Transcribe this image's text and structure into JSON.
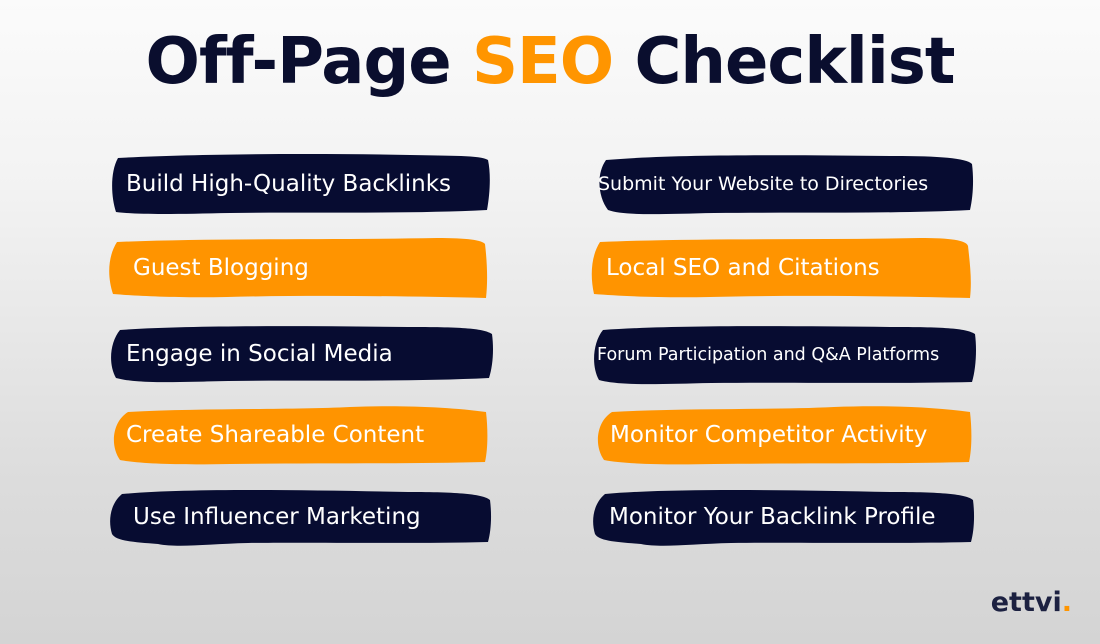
{
  "title": {
    "part1": "Off-Page ",
    "accent": "SEO",
    "part2": " Checklist"
  },
  "colors": {
    "navy": "#070c31",
    "orange": "#ff9400",
    "title_text": "#0a0e2e",
    "accent": "#ff9500"
  },
  "left_column": [
    {
      "label": "Build High-Quality Backlinks",
      "style": "navy"
    },
    {
      "label": "Guest Blogging",
      "style": "orange"
    },
    {
      "label": "Engage in Social Media",
      "style": "navy"
    },
    {
      "label": "Create Shareable Content",
      "style": "orange"
    },
    {
      "label": "Use Influencer Marketing",
      "style": "navy"
    }
  ],
  "right_column": [
    {
      "label": "Submit Your Website to Directories",
      "style": "navy"
    },
    {
      "label": "Local SEO and Citations",
      "style": "orange"
    },
    {
      "label": "Forum Participation and Q&A Platforms",
      "style": "navy"
    },
    {
      "label": "Monitor Competitor Activity",
      "style": "orange"
    },
    {
      "label": "Monitor Your Backlink Profile",
      "style": "navy"
    }
  ],
  "logo": {
    "text": "ettvi",
    "dot": "."
  }
}
